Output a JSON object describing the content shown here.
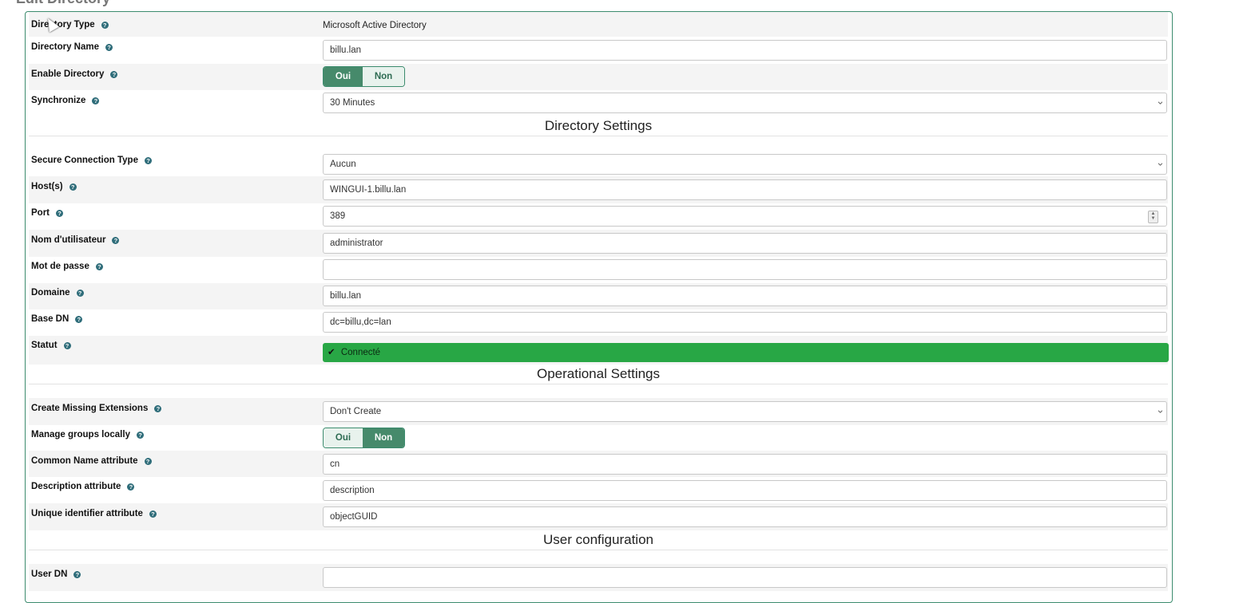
{
  "page": {
    "heading": "Edit Directory"
  },
  "help_glyph": "?",
  "fields": {
    "directory_type": {
      "label": "Directory Type",
      "value": "Microsoft Active Directory"
    },
    "directory_name": {
      "label": "Directory Name",
      "value": "billu.lan"
    },
    "enable_directory": {
      "label": "Enable Directory",
      "yes": "Oui",
      "no": "Non",
      "selected": "Oui"
    },
    "synchronize": {
      "label": "Synchronize",
      "value": "30 Minutes"
    }
  },
  "sections": {
    "directory_settings": "Directory Settings",
    "operational_settings": "Operational Settings",
    "user_configuration": "User configuration"
  },
  "directory_settings": {
    "secure_connection": {
      "label": "Secure Connection Type",
      "value": "Aucun"
    },
    "hosts": {
      "label": "Host(s)",
      "value": "WINGUI-1.billu.lan"
    },
    "port": {
      "label": "Port",
      "value": "389"
    },
    "username": {
      "label": "Nom d'utilisateur",
      "value": "administrator"
    },
    "password": {
      "label": "Mot de passe",
      "value": ""
    },
    "domain": {
      "label": "Domaine",
      "value": "billu.lan"
    },
    "base_dn": {
      "label": "Base DN",
      "value": "dc=billu,dc=lan"
    },
    "status": {
      "label": "Statut",
      "value": "Connecté",
      "color": "#28a745"
    }
  },
  "operational_settings": {
    "create_missing_extensions": {
      "label": "Create Missing Extensions",
      "value": "Don't Create"
    },
    "manage_groups_locally": {
      "label": "Manage groups locally",
      "yes": "Oui",
      "no": "Non",
      "selected": "Non"
    },
    "common_name_attr": {
      "label": "Common Name attribute",
      "value": "cn"
    },
    "description_attr": {
      "label": "Description attribute",
      "value": "description"
    },
    "unique_id_attr": {
      "label": "Unique identifier attribute",
      "value": "objectGUID"
    }
  },
  "user_configuration": {
    "user_dn": {
      "label": "User DN",
      "value": ""
    }
  },
  "colors": {
    "accent": "#468a6b",
    "panel_border": "#3c8c6e",
    "success": "#28a745",
    "help_icon": "#2f6d7a"
  }
}
